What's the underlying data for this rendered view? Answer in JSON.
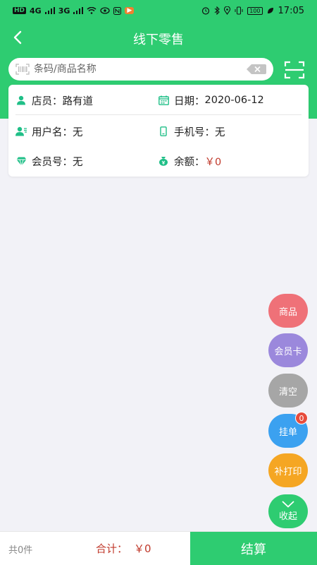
{
  "status_bar": {
    "left_chip": "HD",
    "net1": "4G",
    "net2": "3G",
    "app_badge": "▶",
    "battery": "100",
    "time": "17:05"
  },
  "header": {
    "title": "线下零售"
  },
  "search": {
    "placeholder": "条码/商品名称",
    "value": ""
  },
  "info": {
    "clerk_label": "店员：",
    "clerk_value": "路有道",
    "date_label": "日期：",
    "date_value": "2020-06-12",
    "username_label": "用户名：",
    "username_value": "无",
    "phone_label": "手机号：",
    "phone_value": "无",
    "member_label": "会员号：",
    "member_value": "无",
    "balance_label": "余额：",
    "balance_value": "￥0"
  },
  "fabs": {
    "goods": "商品",
    "member_card": "会员卡",
    "clear": "清空",
    "hold": "挂单",
    "hold_count": "0",
    "reprint": "补打印",
    "collapse": "收起"
  },
  "colors": {
    "primary": "#2ecc71",
    "goods": "#ef7178",
    "member_card": "#9b88dc",
    "clear": "#a6a6a6",
    "hold": "#3ba1f0",
    "reprint": "#f5a623",
    "collapse": "#2ecc71",
    "price": "#c0392b"
  },
  "bottom": {
    "count": "共0件",
    "total_label": "合计：",
    "total_value": "￥0",
    "checkout": "结算"
  }
}
